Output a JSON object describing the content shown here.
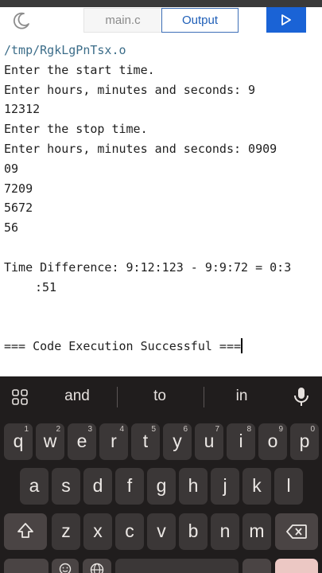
{
  "header": {
    "tab_file": "main.c",
    "tab_output": "Output"
  },
  "output": {
    "lines": [
      "/tmp/RgkLgPnTsx.o",
      "Enter the start time.",
      "Enter hours, minutes and seconds: 9",
      "12312",
      "Enter the stop time.",
      "Enter hours, minutes and seconds: 0909",
      "09",
      "7209",
      "5672",
      "56",
      "",
      "Time Difference: 9:12:123 - 9:9:72 = 0:3",
      ":51",
      "",
      "",
      "=== Code Execution Successful ==="
    ]
  },
  "keyboard": {
    "suggestions": [
      "and",
      "to",
      "in"
    ],
    "row1": [
      {
        "k": "q",
        "h": "1"
      },
      {
        "k": "w",
        "h": "2"
      },
      {
        "k": "e",
        "h": "3"
      },
      {
        "k": "r",
        "h": "4"
      },
      {
        "k": "t",
        "h": "5"
      },
      {
        "k": "y",
        "h": "6"
      },
      {
        "k": "u",
        "h": "7"
      },
      {
        "k": "i",
        "h": "8"
      },
      {
        "k": "o",
        "h": "9"
      },
      {
        "k": "p",
        "h": "0"
      }
    ],
    "row2": [
      "a",
      "s",
      "d",
      "f",
      "g",
      "h",
      "j",
      "k",
      "l"
    ],
    "row3": [
      "z",
      "x",
      "c",
      "v",
      "b",
      "n",
      "m"
    ],
    "icons": {
      "grid": "apps-grid-icon",
      "mic": "microphone-icon",
      "shift": "shift-icon",
      "backspace": "backspace-icon"
    }
  }
}
